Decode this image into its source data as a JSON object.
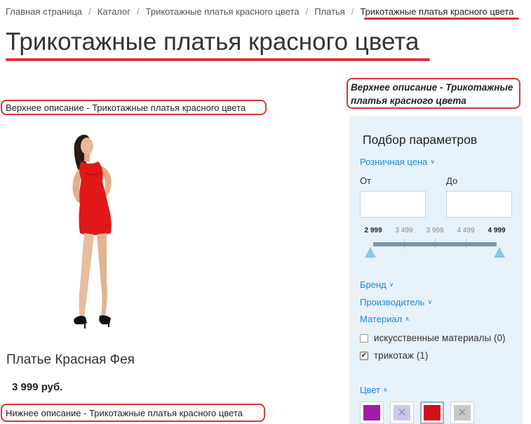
{
  "breadcrumb": {
    "items": [
      {
        "label": "Главная страница"
      },
      {
        "label": "Каталог"
      },
      {
        "label": "Трикотажные платья красного цвета"
      },
      {
        "label": "Платья"
      },
      {
        "label": "Трикотажные платья красного цвета"
      }
    ],
    "separator": "/"
  },
  "page_title": "Трикотажные платья красного цвета",
  "top_description_left": "Верхнее описание - Трикотажные платья красного цвета",
  "top_description_right": "Верхнее описание - Трикотажные платья красного цвета",
  "product": {
    "name": "Платье Красная Фея",
    "price": "3 999 руб."
  },
  "bottom_description": "Нижнее описание - Трикотажные платья красного цвета",
  "filter": {
    "title": "Подбор параметров",
    "price_section": {
      "label": "Розничная цена",
      "from_label": "От",
      "to_label": "До",
      "from_value": "",
      "to_value": "",
      "scale": [
        "2 999",
        "3 499",
        "3 999",
        "4 499",
        "4 999"
      ]
    },
    "sections": [
      {
        "label": "Бренд"
      },
      {
        "label": "Производитель"
      },
      {
        "label": "Материал"
      }
    ],
    "materials": [
      {
        "label": "искусственные материалы (0)",
        "checked": false
      },
      {
        "label": "трикотаж (1)",
        "checked": true
      }
    ],
    "color_section": {
      "label": "Цвет"
    },
    "colors": [
      {
        "color": "#a21aa8",
        "disabled": false,
        "selected": false
      },
      {
        "color": "#c8c8ec",
        "disabled": true,
        "selected": false
      },
      {
        "color": "#d2121a",
        "disabled": false,
        "selected": true
      },
      {
        "color": "#c8c8c8",
        "disabled": true,
        "selected": false
      }
    ]
  },
  "colors": {
    "accent_link": "#1a8ad6",
    "highlight_red": "#dd3333",
    "panel_bg": "#e8f2fa"
  }
}
